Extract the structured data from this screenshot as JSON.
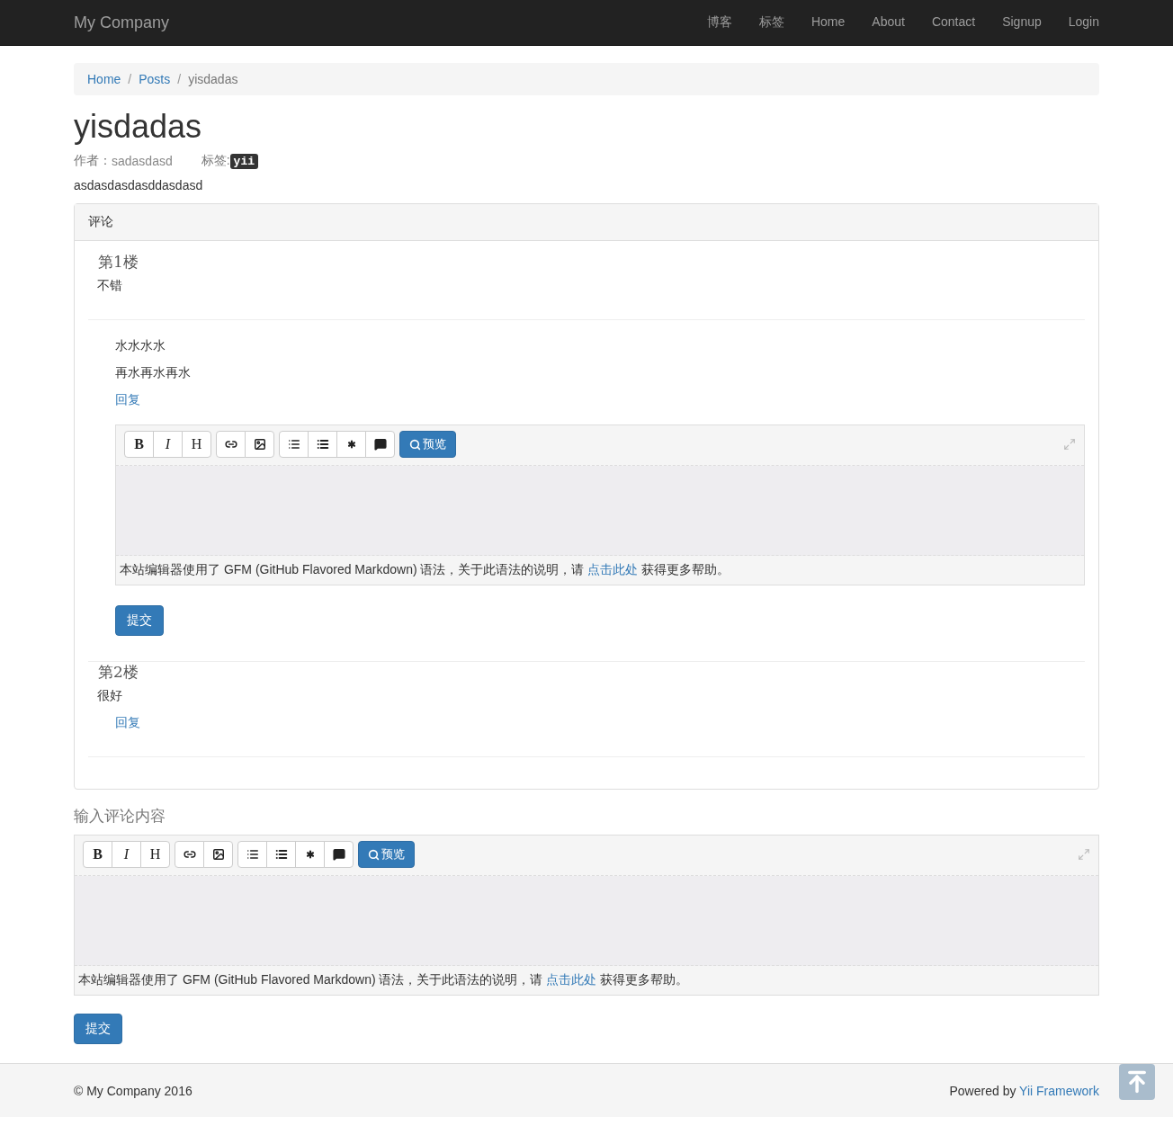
{
  "navbar": {
    "brand": "My Company",
    "links": [
      "博客",
      "标签",
      "Home",
      "About",
      "Contact",
      "Signup",
      "Login"
    ]
  },
  "breadcrumb": [
    {
      "label": "Home",
      "current": false
    },
    {
      "separator": "/",
      "label": "Posts",
      "current": false
    },
    {
      "separator": "/",
      "label": "yisdadas",
      "current": true
    }
  ],
  "post": {
    "title": "yisdadas",
    "author_label": "作者：",
    "author": "sadasdasd",
    "tags_label": "标签:",
    "tags": [
      "yii"
    ],
    "body": "asdasdasdasddasdasd"
  },
  "comments_panel": {
    "heading": "评论",
    "comments": [
      {
        "floor": "第1楼",
        "content": "不错",
        "replies": [
          "水水水水",
          "再水再水再水"
        ],
        "reply_link": "回复",
        "reply_form": {
          "editor": {
            "toolbar": [
              [
                {
                  "kind": "bold",
                  "label": "B"
                },
                {
                  "kind": "italic",
                  "label": "I"
                },
                {
                  "kind": "heading",
                  "label": "H"
                }
              ],
              [
                {
                  "kind": "link"
                },
                {
                  "kind": "image"
                }
              ],
              [
                {
                  "kind": "list"
                },
                {
                  "kind": "list-bold"
                },
                {
                  "kind": "asterisk"
                },
                {
                  "kind": "speech"
                }
              ]
            ],
            "preview": "预览",
            "help_before": "本站编辑器使用了 GFM (GitHub Flavored Markdown) 语法，关于此语法的说明，请",
            "help_link": "点击此处",
            "help_after": "获得更多帮助。"
          },
          "submit": "提交"
        }
      },
      {
        "floor": "第2楼",
        "content": "很好",
        "reply_link": "回复"
      }
    ]
  },
  "new_comment": {
    "heading": "输入评论内容",
    "editor": {
      "toolbar": [
        [
          {
            "kind": "bold",
            "label": "B"
          },
          {
            "kind": "italic",
            "label": "I"
          },
          {
            "kind": "heading",
            "label": "H"
          }
        ],
        [
          {
            "kind": "link"
          },
          {
            "kind": "image"
          }
        ],
        [
          {
            "kind": "list"
          },
          {
            "kind": "list-bold"
          },
          {
            "kind": "asterisk"
          },
          {
            "kind": "speech"
          }
        ]
      ],
      "preview": "预览",
      "help_before": "本站编辑器使用了 GFM (GitHub Flavored Markdown) 语法，关于此语法的说明，请",
      "help_link": "点击此处",
      "help_after": "获得更多帮助。"
    },
    "submit": "提交"
  },
  "footer": {
    "copyright": "© My Company 2016",
    "powered": "Powered by",
    "framework": "Yii Framework"
  }
}
